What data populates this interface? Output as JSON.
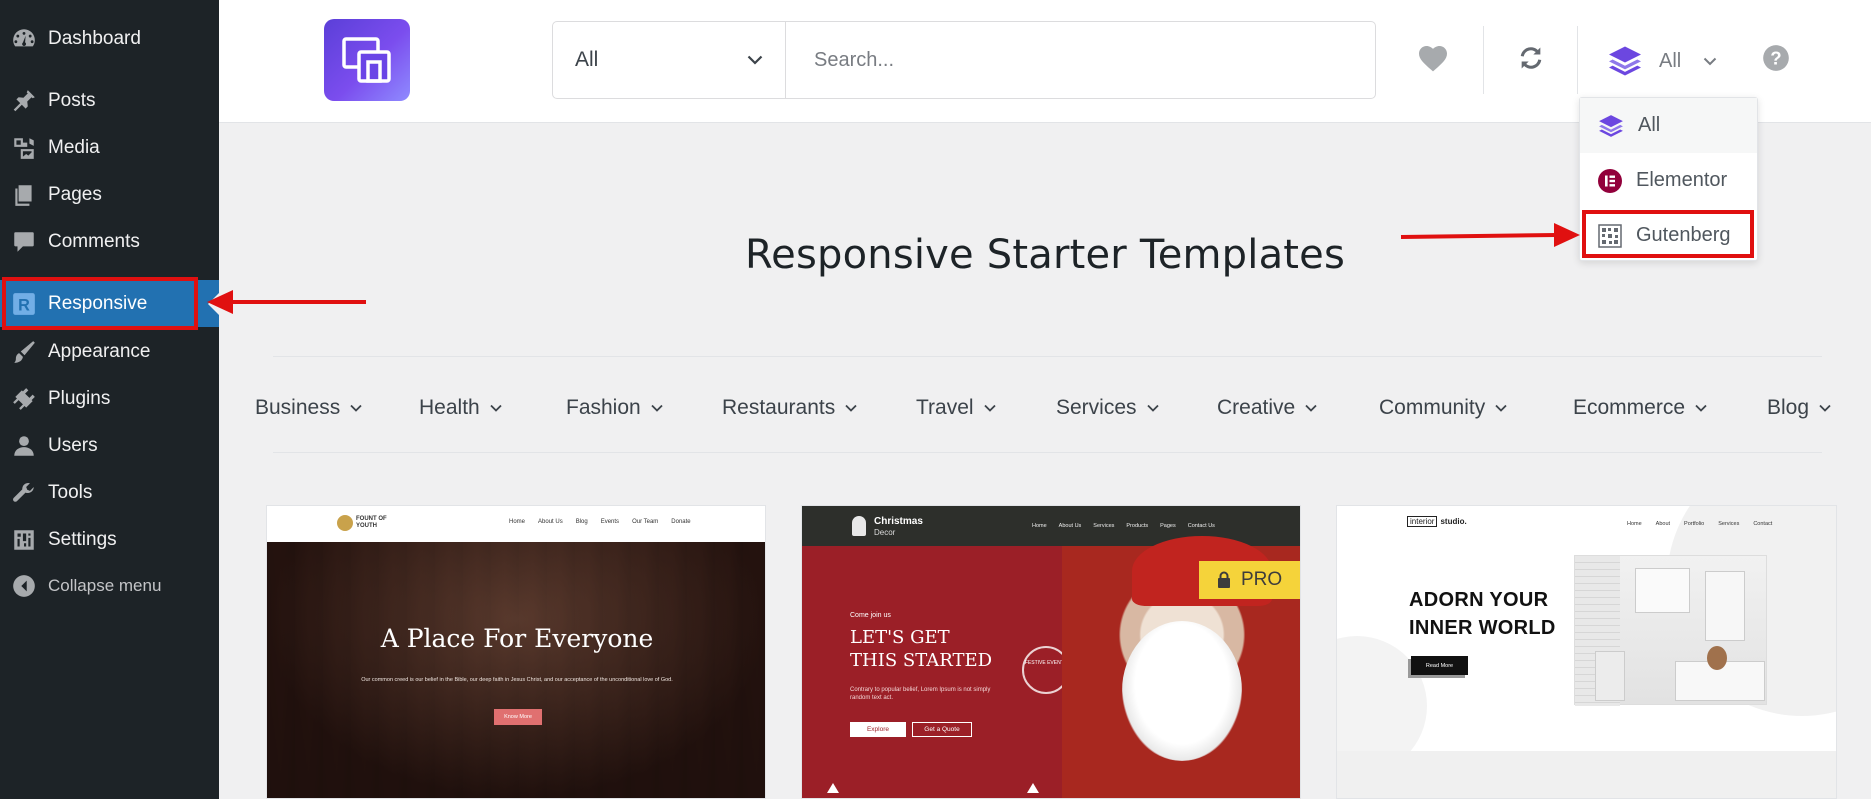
{
  "sidebar": {
    "items": [
      {
        "label": "Dashboard"
      },
      {
        "label": "Posts"
      },
      {
        "label": "Media"
      },
      {
        "label": "Pages"
      },
      {
        "label": "Comments"
      },
      {
        "label": "Responsive"
      },
      {
        "label": "Appearance"
      },
      {
        "label": "Plugins"
      },
      {
        "label": "Users"
      },
      {
        "label": "Tools"
      },
      {
        "label": "Settings"
      },
      {
        "label": "Collapse menu"
      }
    ],
    "active": "Responsive"
  },
  "header": {
    "category_select": "All",
    "search_placeholder": "Search...",
    "builder_select": "All"
  },
  "builder_dropdown": {
    "options": [
      "All",
      "Elementor",
      "Gutenberg"
    ],
    "selected": "All",
    "highlighted": "Gutenberg"
  },
  "main": {
    "title": "Responsive Starter Templates",
    "categories": [
      "Business",
      "Health",
      "Fashion",
      "Restaurants",
      "Travel",
      "Services",
      "Creative",
      "Community",
      "Ecommerce",
      "Blog"
    ]
  },
  "cards": [
    {
      "brand": "FOUNT OF YOUTH",
      "nav": [
        "Home",
        "About Us",
        "Blog",
        "Events",
        "Our Team",
        "Donate"
      ],
      "heading": "A Place For Everyone",
      "body": "Our common creed is our belief in the Bible, our deep faith in Jesus Christ, and our acceptance of the unconditional love of God.",
      "button": "Know More"
    },
    {
      "brand_line1": "Christmas",
      "brand_line2": "Decor",
      "nav": [
        "Home",
        "About Us",
        "Services",
        "Products",
        "Pages",
        "Contact Us"
      ],
      "badge": "PRO",
      "kicker": "Come join us",
      "heading_line1": "LET'S GET",
      "heading_line2": "THIS STARTED",
      "body": "Contrary to popular belief, Lorem Ipsum is not simply random text act.",
      "button1": "Explore",
      "button2": "Get a Quote",
      "emblem": "FESTIVE EVENTS"
    },
    {
      "brand_box": "interior",
      "brand_rest": "studio.",
      "nav": [
        "Home",
        "About",
        "Portfolio",
        "Services",
        "Contact"
      ],
      "heading_line1": "ADORN YOUR",
      "heading_line2": "INNER WORLD",
      "button": "Read More"
    }
  ],
  "colors": {
    "sidebar_bg": "#1d2327",
    "sidebar_active": "#2271b1",
    "annotation": "#e01010",
    "pro_badge": "#f5d33a",
    "logo_gradient": [
      "#5b3fd8",
      "#8f8bff"
    ]
  }
}
